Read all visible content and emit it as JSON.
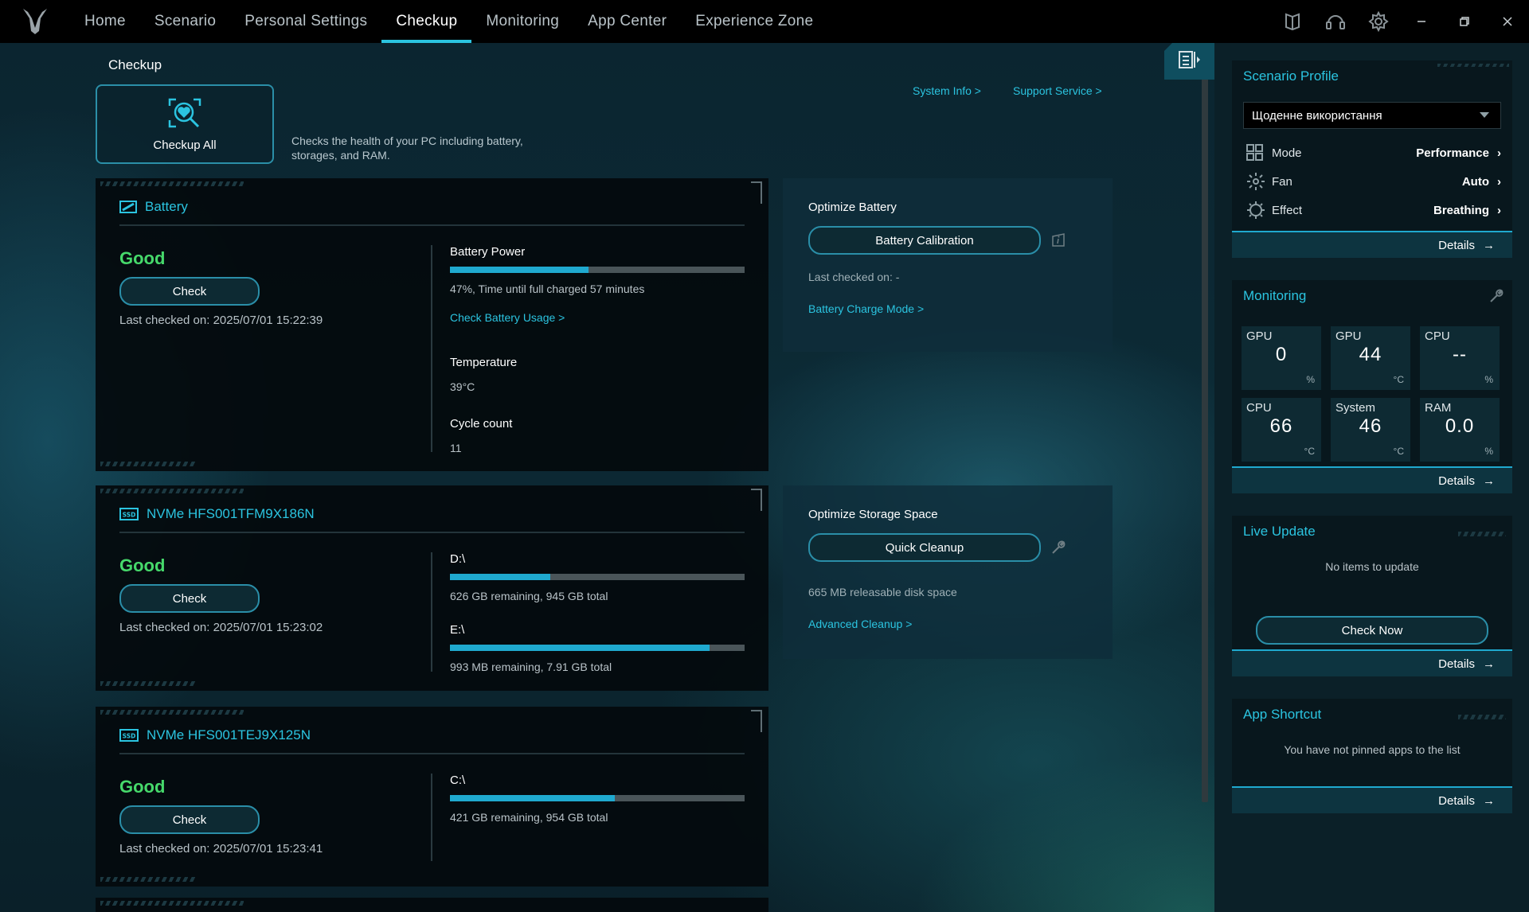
{
  "nav": {
    "items": [
      {
        "label": "Home"
      },
      {
        "label": "Scenario"
      },
      {
        "label": "Personal Settings"
      },
      {
        "label": "Checkup",
        "active": true
      },
      {
        "label": "Monitoring"
      },
      {
        "label": "App Center"
      },
      {
        "label": "Experience Zone"
      }
    ],
    "icons": [
      "guide-icon",
      "headset-icon",
      "settings-gear-icon",
      "minimize-icon",
      "restore-icon",
      "close-icon"
    ]
  },
  "page": {
    "title": "Checkup",
    "checkup_all_label": "Checkup All",
    "description": "Checks the health of your PC including battery, storages, and RAM.",
    "system_info_link": "System Info >",
    "support_service_link": "Support Service >"
  },
  "battery": {
    "title": "Battery",
    "status": "Good",
    "check_label": "Check",
    "last_checked": "Last checked on: 2025/07/01 15:22:39",
    "power_label": "Battery Power",
    "power_percent": 47,
    "power_text": "47%, Time until full charged 57 minutes",
    "usage_link": "Check Battery Usage >",
    "temperature_label": "Temperature",
    "temperature_value": "39°C",
    "cycle_label": "Cycle count",
    "cycle_value": "11",
    "optimize": {
      "title": "Optimize Battery",
      "button": "Battery Calibration",
      "last_checked": "Last checked on: -",
      "link": "Battery Charge Mode >"
    }
  },
  "drive1": {
    "title": "NVMe HFS001TFM9X186N",
    "status": "Good",
    "check_label": "Check",
    "last_checked": "Last checked on: 2025/07/01 15:23:02",
    "partitions": [
      {
        "name": "D:\\",
        "used_fraction": 0.34,
        "text": "626 GB remaining, 945 GB total"
      },
      {
        "name": "E:\\",
        "used_fraction": 0.88,
        "text": "993 MB remaining, 7.91 GB total"
      }
    ],
    "optimize": {
      "title": "Optimize Storage Space",
      "button": "Quick Cleanup",
      "text": "665 MB releasable disk space",
      "link": "Advanced Cleanup >"
    }
  },
  "drive2": {
    "title": "NVMe HFS001TEJ9X125N",
    "status": "Good",
    "check_label": "Check",
    "last_checked": "Last checked on: 2025/07/01 15:23:41",
    "partitions": [
      {
        "name": "C:\\",
        "used_fraction": 0.56,
        "text": "421 GB remaining, 954 GB total"
      }
    ]
  },
  "sidebar": {
    "profile": {
      "title": "Scenario Profile",
      "selected": "Щоденне використання",
      "rows": [
        {
          "label": "Mode",
          "value": "Performance"
        },
        {
          "label": "Fan",
          "value": "Auto"
        },
        {
          "label": "Effect",
          "value": "Breathing"
        }
      ],
      "details": "Details"
    },
    "monitoring": {
      "title": "Monitoring",
      "tiles": [
        {
          "label": "GPU",
          "value": "0",
          "unit": "%"
        },
        {
          "label": "GPU",
          "value": "44",
          "unit": "°C"
        },
        {
          "label": "CPU",
          "value": "--",
          "unit": "%"
        },
        {
          "label": "CPU",
          "value": "66",
          "unit": "°C"
        },
        {
          "label": "System",
          "value": "46",
          "unit": "°C"
        },
        {
          "label": "RAM",
          "value": "0.0",
          "unit": "%"
        }
      ],
      "details": "Details"
    },
    "live_update": {
      "title": "Live Update",
      "message": "No items to update",
      "button": "Check Now",
      "details": "Details"
    },
    "app_shortcut": {
      "title": "App Shortcut",
      "message": "You have not pinned apps to the list",
      "details": "Details"
    }
  },
  "colors": {
    "accent": "#2bc4e0",
    "good": "#46d96b",
    "bar_fill": "#1fa9cf"
  }
}
